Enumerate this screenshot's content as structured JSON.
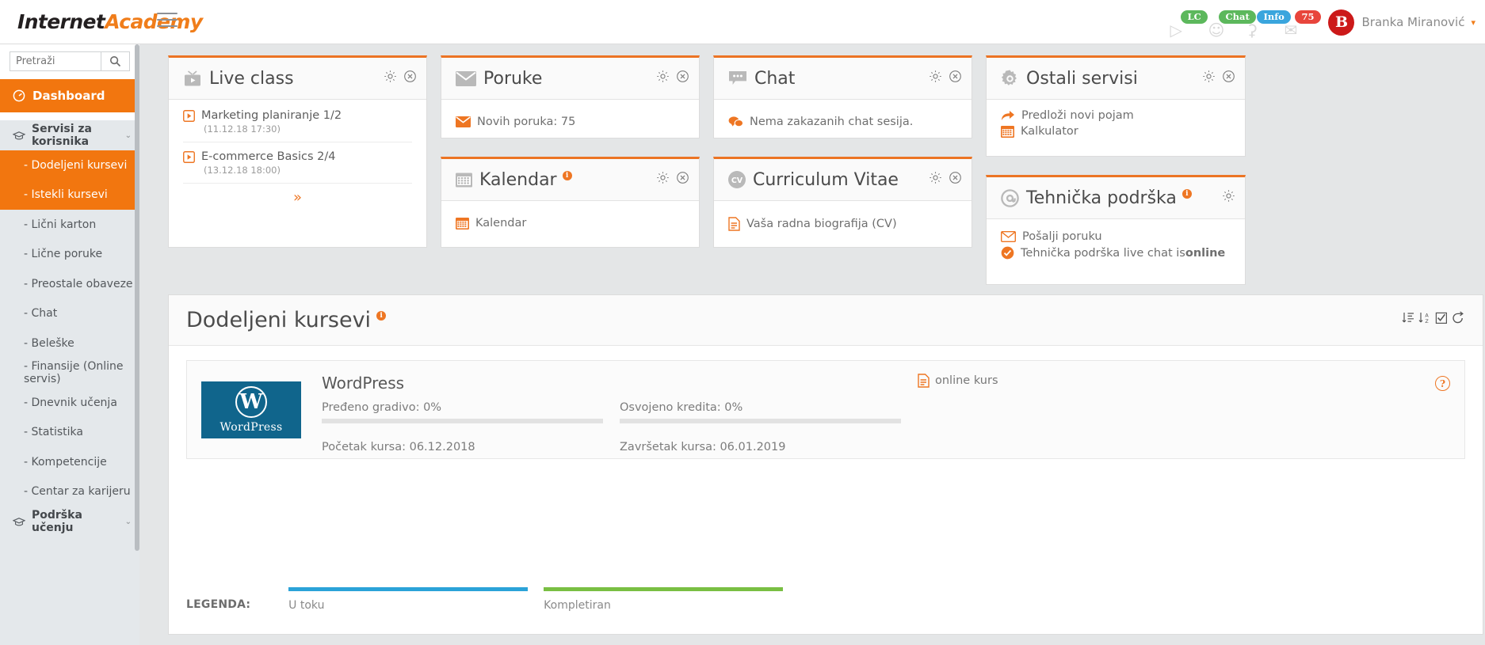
{
  "brand": {
    "part1": "Internet",
    "part2": "Academy"
  },
  "header": {
    "menu_icon": "hamburger-icon",
    "notifications": [
      {
        "icon": "live-class-icon",
        "badge": "LC",
        "color": "#5cb85c"
      },
      {
        "icon": "contacts-icon",
        "badge": "Chat",
        "color": "#5cb85c"
      },
      {
        "icon": "bell-icon",
        "badge": "Info",
        "color": "#3aa5dd"
      },
      {
        "icon": "envelope-icon",
        "badge": "75",
        "color": "#e8453c"
      }
    ],
    "avatar_initial": "B",
    "user_name": "Branka Miranović",
    "caret": "▾"
  },
  "sidebar": {
    "search": {
      "placeholder": "Pretraži",
      "value": "",
      "icon": "search-icon"
    },
    "dashboard": {
      "label": "Dashboard",
      "icon": "dashboard-icon"
    },
    "group1": {
      "label": "Servisi za korisnika",
      "icon": "graduation-cap-icon",
      "chevron": "⌄"
    },
    "items": [
      {
        "label": "- Dodeljeni kursevi",
        "active": true
      },
      {
        "label": "- Istekli kursevi",
        "active": true
      },
      {
        "label": "- Lični karton",
        "active": false
      },
      {
        "label": "- Lične poruke",
        "active": false
      },
      {
        "label": "- Preostale obaveze",
        "active": false
      },
      {
        "label": "- Chat",
        "active": false
      },
      {
        "label": "- Beleške",
        "active": false
      },
      {
        "label": "- Finansije (Online servis)",
        "active": false
      },
      {
        "label": "- Dnevnik učenja",
        "active": false
      },
      {
        "label": "- Statistika",
        "active": false
      },
      {
        "label": "- Kompetencije",
        "active": false
      },
      {
        "label": "- Centar za karijeru",
        "active": false
      }
    ],
    "group2": {
      "label": "Podrška učenju",
      "icon": "graduation-cap-icon",
      "chevron": "⌄"
    }
  },
  "widgets": {
    "live_class": {
      "title": "Live class",
      "icon": "tv-play-icon",
      "gear": "gear-icon",
      "close": "close-icon",
      "items": [
        {
          "name": "Marketing planiranje 1/2",
          "date": "(11.12.18 17:30)"
        },
        {
          "name": "E-commerce Basics 2/4",
          "date": "(13.12.18 18:00)"
        }
      ],
      "more_icon": "chevron-double-down-icon"
    },
    "poruke": {
      "title": "Poruke",
      "icon": "envelope-icon",
      "gear": "gear-icon",
      "close": "close-icon",
      "row": {
        "icon": "envelope-orange-icon",
        "text": "Novih poruka: 75"
      }
    },
    "kalendar": {
      "title": "Kalendar",
      "icon": "calendar-icon",
      "info": "i",
      "gear": "gear-icon",
      "close": "close-icon",
      "row": {
        "icon": "calendar-orange-icon",
        "text": "Kalendar"
      }
    },
    "chat": {
      "title": "Chat",
      "icon": "chat-bubble-icon",
      "gear": "gear-icon",
      "close": "close-icon",
      "row": {
        "icon": "chat-bubbles-orange-icon",
        "text": "Nema zakazanih chat sesija."
      }
    },
    "cv": {
      "title": "Curriculum Vitae",
      "icon": "cv-icon",
      "gear": "gear-icon",
      "close": "close-icon",
      "row": {
        "icon": "document-orange-icon",
        "text": "Vaša radna biografija (CV)"
      }
    },
    "ostali": {
      "title": "Ostali servisi",
      "icon": "gear-big-icon",
      "gear": "gear-icon",
      "close": "close-icon",
      "rows": [
        {
          "icon": "arrow-forward-orange-icon",
          "text": "Predloži novi pojam"
        },
        {
          "icon": "calculator-orange-icon",
          "text": "Kalkulator"
        }
      ]
    },
    "podrska": {
      "title": "Tehnička podrška",
      "icon": "at-sign-icon",
      "info": "i",
      "gear": "gear-icon",
      "rows": [
        {
          "icon": "envelope-orange-icon",
          "text": "Pošalji poruku"
        },
        {
          "icon": "check-circle-orange-icon",
          "text": "Tehnička podrška live chat is ",
          "strong": "online"
        }
      ]
    }
  },
  "panel": {
    "title": "Dodeljeni kursevi",
    "info": "i",
    "tools": [
      {
        "icon": "sort-numeric-icon"
      },
      {
        "icon": "sort-alpha-icon"
      },
      {
        "icon": "checkbox-icon"
      },
      {
        "icon": "refresh-icon"
      }
    ],
    "course": {
      "logo_mark": "W",
      "logo_word": "WordPress",
      "name": "WordPress",
      "progress_label": "Pređeno gradivo: 0%",
      "progress_value": 0,
      "credits_label": "Osvojeno kredita: 0%",
      "credits_value": 0,
      "start_label": "Početak kursa: 06.12.2018",
      "end_label": "Završetak kursa: 06.01.2019",
      "link": {
        "icon": "document-orange-icon",
        "text": "online kurs"
      },
      "help": "?"
    },
    "legend": {
      "label": "LEGENDA:",
      "entries": [
        {
          "text": "U toku",
          "color": "#2ba3d8"
        },
        {
          "text": "Kompletiran",
          "color": "#79bf43"
        }
      ]
    }
  }
}
